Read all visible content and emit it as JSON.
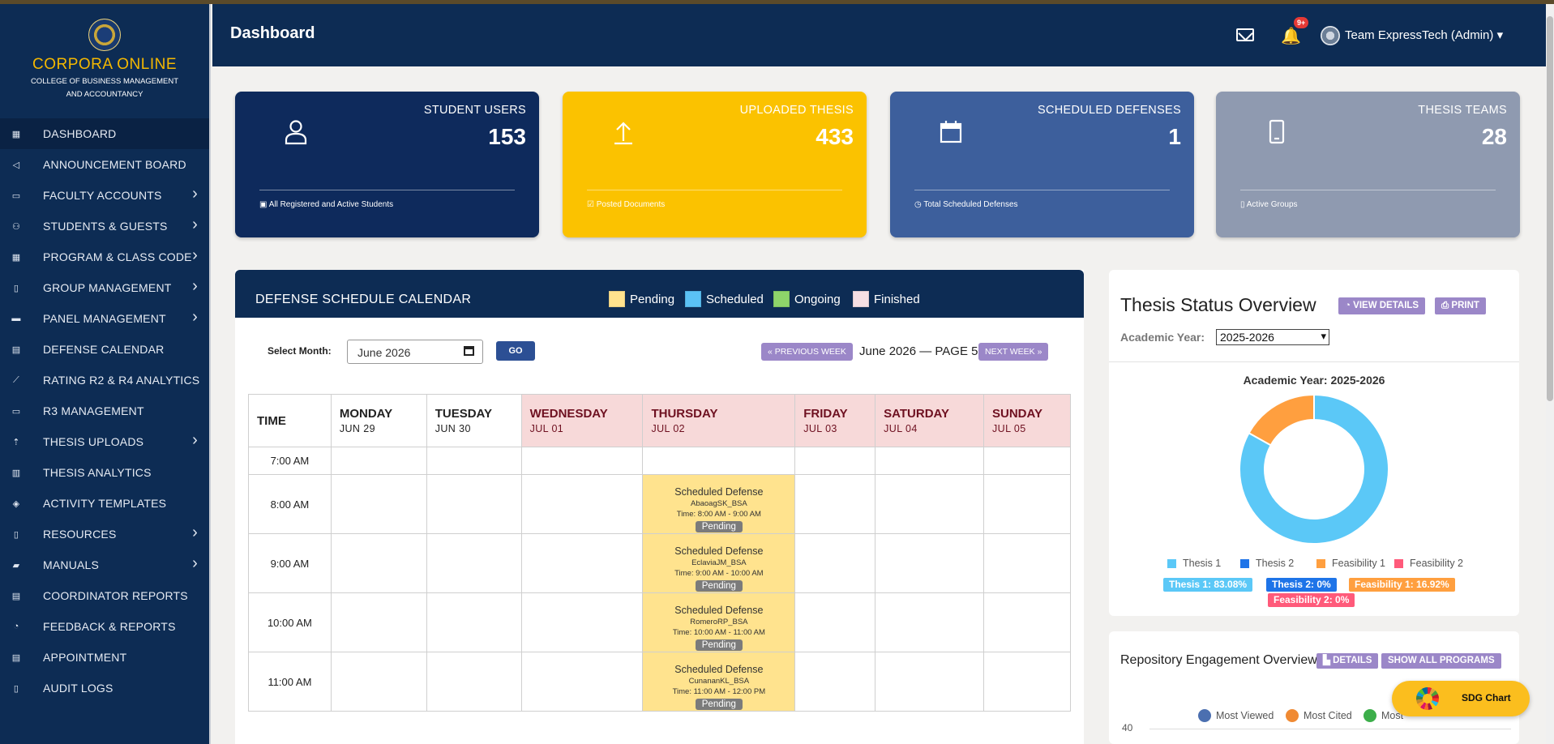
{
  "app": {
    "brand_title": "CORPORA ONLINE",
    "brand_sub_line1": "COLLEGE OF BUSINESS MANAGEMENT",
    "brand_sub_line2": "AND ACCOUNTANCY"
  },
  "sidebar": {
    "items": [
      {
        "label": "DASHBOARD",
        "icon": "dashboard-icon",
        "submenu": false,
        "active": true
      },
      {
        "label": "ANNOUNCEMENT BOARD",
        "icon": "megaphone-icon",
        "submenu": false
      },
      {
        "label": "FACULTY ACCOUNTS",
        "icon": "id-card-icon",
        "submenu": true
      },
      {
        "label": "STUDENTS & GUESTS",
        "icon": "user-icon",
        "submenu": true
      },
      {
        "label": "PROGRAM & CLASS CODE",
        "icon": "grid-icon",
        "submenu": true
      },
      {
        "label": "GROUP MANAGEMENT",
        "icon": "tablet-icon",
        "submenu": true
      },
      {
        "label": "PANEL MANAGEMENT",
        "icon": "money-icon",
        "submenu": true
      },
      {
        "label": "DEFENSE CALENDAR",
        "icon": "calendar-icon",
        "submenu": false
      },
      {
        "label": "RATING R2 & R4 ANALYTICS",
        "icon": "line-chart-icon",
        "submenu": false
      },
      {
        "label": "R3 MANAGEMENT",
        "icon": "comment-icon",
        "submenu": false
      },
      {
        "label": "THESIS UPLOADS",
        "icon": "upload-icon",
        "submenu": true
      },
      {
        "label": "THESIS ANALYTICS",
        "icon": "bar-chart-icon",
        "submenu": false
      },
      {
        "label": "ACTIVITY TEMPLATES",
        "icon": "layers-icon",
        "submenu": false
      },
      {
        "label": "RESOURCES",
        "icon": "file-icon",
        "submenu": true
      },
      {
        "label": "MANUALS",
        "icon": "book-icon",
        "submenu": true
      },
      {
        "label": "COORDINATOR REPORTS",
        "icon": "report-icon",
        "submenu": false
      },
      {
        "label": "FEEDBACK & REPORTS",
        "icon": "comments-icon",
        "submenu": false
      },
      {
        "label": "APPOINTMENT",
        "icon": "calendar-icon",
        "submenu": false
      },
      {
        "label": "AUDIT LOGS",
        "icon": "clipboard-icon",
        "submenu": false
      }
    ]
  },
  "header": {
    "title": "Dashboard",
    "notifications_badge": "9+",
    "user_label": "Team ExpressTech (Admin)"
  },
  "stats": [
    {
      "label": "STUDENT USERS",
      "value": "153",
      "footer": "All Registered and Active Students",
      "icon": "user-icon",
      "color": "#0e2a5c"
    },
    {
      "label": "UPLOADED THESIS",
      "value": "433",
      "footer": "Posted Documents",
      "icon": "upload-icon",
      "color": "#fbc200"
    },
    {
      "label": "SCHEDULED DEFENSES",
      "value": "1",
      "footer": "Total Scheduled Defenses",
      "icon": "calendar-icon",
      "color": "#3d5f9c"
    },
    {
      "label": "THESIS TEAMS",
      "value": "28",
      "footer": "Active Groups",
      "icon": "mobile-icon",
      "color": "#8f9ab0"
    }
  ],
  "calendar": {
    "title": "DEFENSE SCHEDULE CALENDAR",
    "legend": [
      {
        "label": "Pending",
        "color": "#ffe38e"
      },
      {
        "label": "Scheduled",
        "color": "#5bc2f5"
      },
      {
        "label": "Ongoing",
        "color": "#8ed46a"
      },
      {
        "label": "Finished",
        "color": "#f6dfe4"
      }
    ],
    "select_month_label": "Select Month:",
    "month_value": "June  2026",
    "go_label": "GO",
    "prev_label": "« PREVIOUS WEEK",
    "page_info": "June 2026 — PAGE 5",
    "next_label": "NEXT WEEK »",
    "time_header": "TIME",
    "days": [
      {
        "name": "MONDAY",
        "date": "JUN 29",
        "weekend": false
      },
      {
        "name": "TUESDAY",
        "date": "JUN 30",
        "weekend": false
      },
      {
        "name": "WEDNESDAY",
        "date": "JUL 01",
        "weekend": true
      },
      {
        "name": "THURSDAY",
        "date": "JUL 02",
        "weekend": true
      },
      {
        "name": "FRIDAY",
        "date": "JUL 03",
        "weekend": true
      },
      {
        "name": "SATURDAY",
        "date": "JUL 04",
        "weekend": true
      },
      {
        "name": "SUNDAY",
        "date": "JUL 05",
        "weekend": true
      }
    ],
    "rows": [
      {
        "time": "7:00 AM"
      },
      {
        "time": "8:00 AM",
        "event": {
          "title": "Scheduled Defense",
          "group": "AbaoagSK_BSA",
          "time": "Time: 8:00 AM - 9:00 AM",
          "status": "Pending"
        }
      },
      {
        "time": "9:00 AM",
        "event": {
          "title": "Scheduled Defense",
          "group": "EclaviaJM_BSA",
          "time": "Time: 9:00 AM - 10:00 AM",
          "status": "Pending"
        }
      },
      {
        "time": "10:00 AM",
        "event": {
          "title": "Scheduled Defense",
          "group": "RomeroRP_BSA",
          "time": "Time: 10:00 AM - 11:00 AM",
          "status": "Pending"
        }
      },
      {
        "time": "11:00 AM",
        "event": {
          "title": "Scheduled Defense",
          "group": "CunananKL_BSA",
          "time": "Time: 11:00 AM - 12:00 PM",
          "status": "Pending"
        }
      }
    ]
  },
  "thesis_status": {
    "title": "Thesis Status Overview",
    "view_details": "VIEW DETAILS",
    "print": "PRINT",
    "academic_year_label": "Academic Year:",
    "academic_year_value": "2025-2026",
    "chart_title": "Academic Year: 2025-2026",
    "tags": [
      "Thesis 1: 83.08%",
      "Thesis 2: 0%",
      "Feasibility 1: 16.92%",
      "Feasibility 2: 0%"
    ]
  },
  "chart_data": {
    "type": "pie",
    "title": "Academic Year: 2025-2026",
    "categories": [
      "Thesis 1",
      "Thesis 2",
      "Feasibility 1",
      "Feasibility 2"
    ],
    "values": [
      83.08,
      0,
      16.92,
      0
    ],
    "colors": [
      "#5bc8f7",
      "#1e74e8",
      "#ff9f3f",
      "#ff5a7a"
    ],
    "donut": true,
    "legend": "bottom"
  },
  "repository": {
    "title": "Repository Engagement Overview",
    "details": "DETAILS",
    "show_all": "SHOW ALL PROGRAMS",
    "legend": [
      {
        "label": "Most Viewed",
        "color": "#4b6fb0"
      },
      {
        "label": "Most Cited",
        "color": "#f08a33"
      },
      {
        "label": "Most",
        "color": "#3cae4a"
      }
    ],
    "axis_top": "40"
  },
  "sdg": {
    "label": "SDG Chart"
  }
}
